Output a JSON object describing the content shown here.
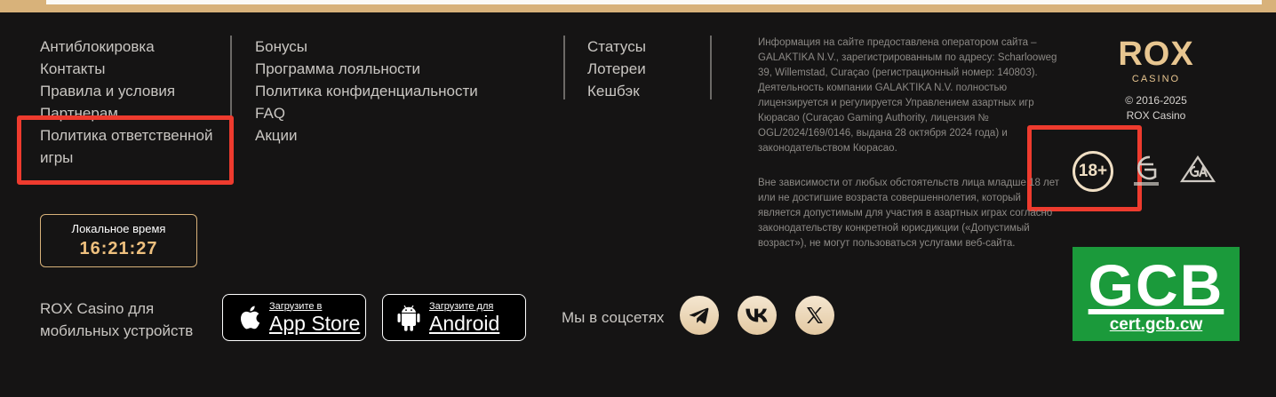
{
  "nav": {
    "col1": [
      "Антиблокировка",
      "Контакты",
      "Правила и условия",
      "Партнерам",
      "Политика ответственной игры"
    ],
    "col2": [
      "Бонусы",
      "Программа лояльности",
      "Политика конфиденциальности",
      "FAQ",
      "Акции"
    ],
    "col3": [
      "Статусы",
      "Лотереи",
      "Кешбэк"
    ]
  },
  "local_time": {
    "label": "Локальное время",
    "value": "16:21:27"
  },
  "mobile": {
    "text": "ROX Casino для мобильных устройств",
    "app_store": {
      "small": "Загрузите в",
      "big": "App Store"
    },
    "android": {
      "small": "Загрузите для",
      "big": "Android"
    }
  },
  "social": {
    "label": "Мы в соцсетях",
    "icons": [
      "telegram-icon",
      "vk-icon",
      "x-icon"
    ]
  },
  "legal": {
    "p1": "Информация на сайте предоставлена оператором сайта – GALAKTIKA N.V., зарегистрированным по адресу: Scharlooweg 39, Willemstad, Curaçao (регистрационный номер: 140803). Деятельность компании GALAKTIKA N.V. полностью лицензируется и регулируется Управлением азартных игр Кюрасао (Curaçao Gaming Authority, лицензия № OGL/2024/169/0146, выдана 28 октября 2024 года) и законодательством Кюрасао.",
    "p2": "Вне зависимости от любых обстоятельств лица младше 18 лет или не достигшие возраста совершеннолетия, который является допустимым для участия в азартных играх согласно законодательству конкретной юрисдикции («Допустимый возраст»), не могут пользоваться услугами веб-сайта."
  },
  "brand": {
    "logo_word": "ROX",
    "logo_sub": "CASINO",
    "copyright_years": "© 2016-2025",
    "copyright_name": "ROX Casino"
  },
  "badges": {
    "age": "18+"
  },
  "gcb": {
    "big": "GCB",
    "small": "cert.gcb.cw"
  },
  "colors": {
    "background": "#151414",
    "accent": "#d8b27a",
    "highlight": "#ee3b2e",
    "gcb_green": "#1b9a3b"
  }
}
